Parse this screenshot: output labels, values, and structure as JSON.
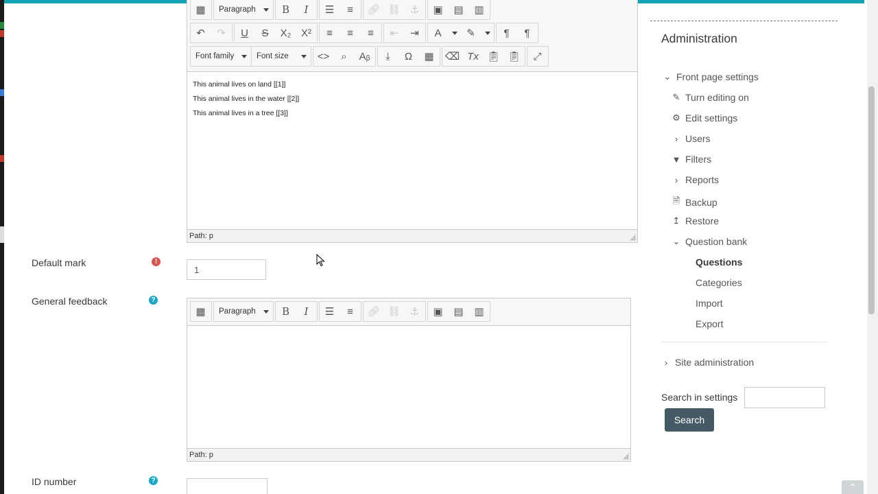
{
  "editor_main": {
    "toolbar_row1": {
      "format_select": "Paragraph"
    },
    "toolbar_row3": {
      "font_family_select": "Font family",
      "font_size_select": "Font size"
    },
    "lines": [
      "This animal lives on land [[1]]",
      "This animal lives in the water [[2]]",
      "This animal lives in a tree [[3]]"
    ],
    "status": "Path: p"
  },
  "form": {
    "default_mark": {
      "label": "Default mark",
      "value": "1"
    },
    "general_feedback": {
      "label": "General feedback",
      "format_select": "Paragraph",
      "status": "Path: p"
    },
    "id_number": {
      "label": "ID number",
      "value": ""
    }
  },
  "admin": {
    "title": "Administration",
    "items": [
      {
        "label": "Front page settings",
        "icon": "chevron-down-icon"
      },
      {
        "label": "Turn editing on",
        "icon": "pencil-icon"
      },
      {
        "label": "Edit settings",
        "icon": "gear-icon"
      },
      {
        "label": "Users",
        "icon": "chevron-right-icon"
      },
      {
        "label": "Filters",
        "icon": "filter-icon"
      },
      {
        "label": "Reports",
        "icon": "chevron-right-icon"
      },
      {
        "label": "Backup",
        "icon": "file-icon"
      },
      {
        "label": "Restore",
        "icon": "upload-icon"
      },
      {
        "label": "Question bank",
        "icon": "chevron-down-icon"
      },
      {
        "label": "Questions",
        "icon": ""
      },
      {
        "label": "Categories",
        "icon": ""
      },
      {
        "label": "Import",
        "icon": ""
      },
      {
        "label": "Export",
        "icon": ""
      },
      {
        "label": "Site administration",
        "icon": "chevron-right-icon"
      }
    ],
    "search_label": "Search in settings",
    "search_value": "",
    "search_button": "Search"
  },
  "colors": {
    "accent_line": "#12a3b4",
    "search_button": "#465a65",
    "required": "#d9534f",
    "help": "#1ba7c8"
  }
}
